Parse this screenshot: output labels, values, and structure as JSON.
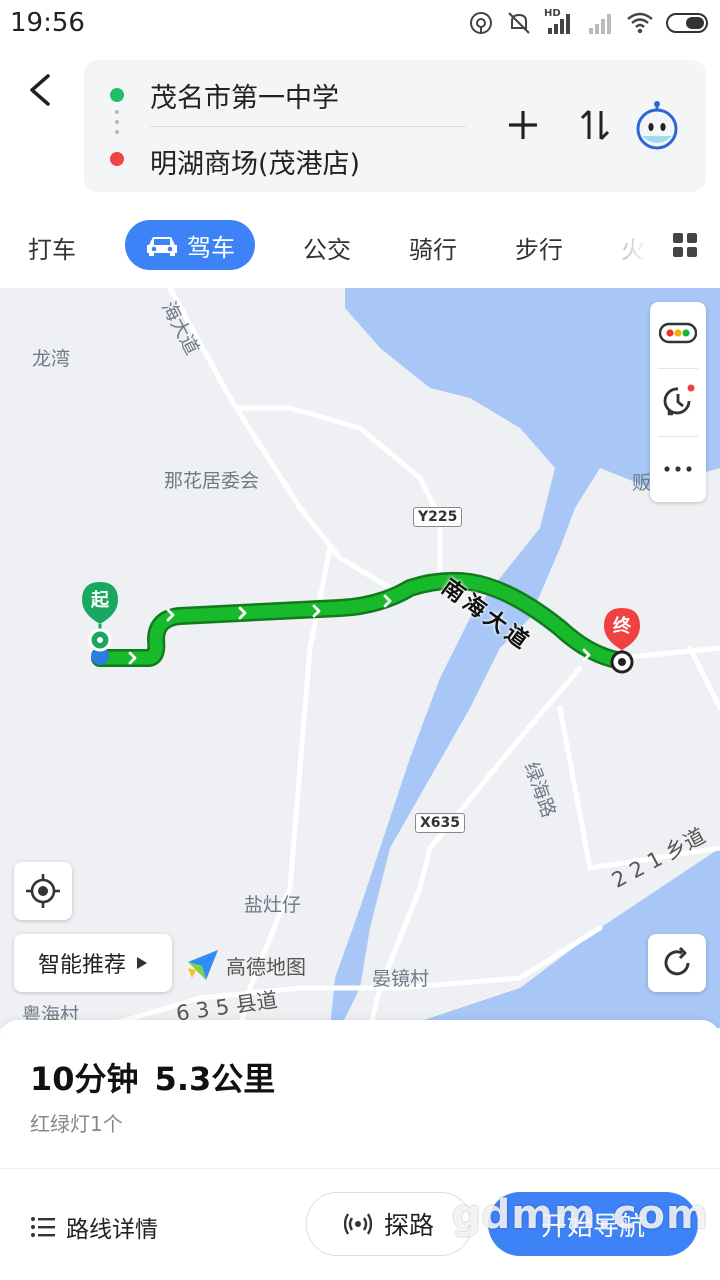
{
  "status_bar": {
    "time": "19:56",
    "hd_label": "HD"
  },
  "route": {
    "origin": "茂名市第一中学",
    "destination": "明湖商场(茂港店)"
  },
  "tabs": [
    {
      "label": "打车"
    },
    {
      "label": "驾车",
      "active": true
    },
    {
      "label": "公交"
    },
    {
      "label": "骑行"
    },
    {
      "label": "步行"
    },
    {
      "label": "火"
    }
  ],
  "map": {
    "labels": {
      "longwan": "龙湾",
      "nahua": "那花居委会",
      "yanzaozai": "盐灶仔",
      "yanjing": "晏镜村",
      "yuehai": "粤海村",
      "lvhai_road": "绿海路",
      "nanhai_ave_top": "海大道",
      "township_221": "2 2 1 乡道",
      "county_635": "6 3 5 县道",
      "edge_char": "贩"
    },
    "road_badges": {
      "y225": "Y225",
      "x635": "X635"
    },
    "route_road_name": "南海大道",
    "start_marker": "起",
    "end_marker": "终",
    "smart_recommend": "智能推荐",
    "logo_text": "高德地图",
    "colors": {
      "route": "#19b92c",
      "water": "#a8c7f6",
      "accent": "#3d82f7",
      "end": "#f04141",
      "start": "#1aa861"
    }
  },
  "summary": {
    "duration": "10分钟",
    "distance": "5.3公里",
    "traffic_lights": "红绿灯1个"
  },
  "actions": {
    "route_detail": "路线详情",
    "explore": "探路",
    "start_nav": "开始导航"
  },
  "watermark": "gdmm.com"
}
